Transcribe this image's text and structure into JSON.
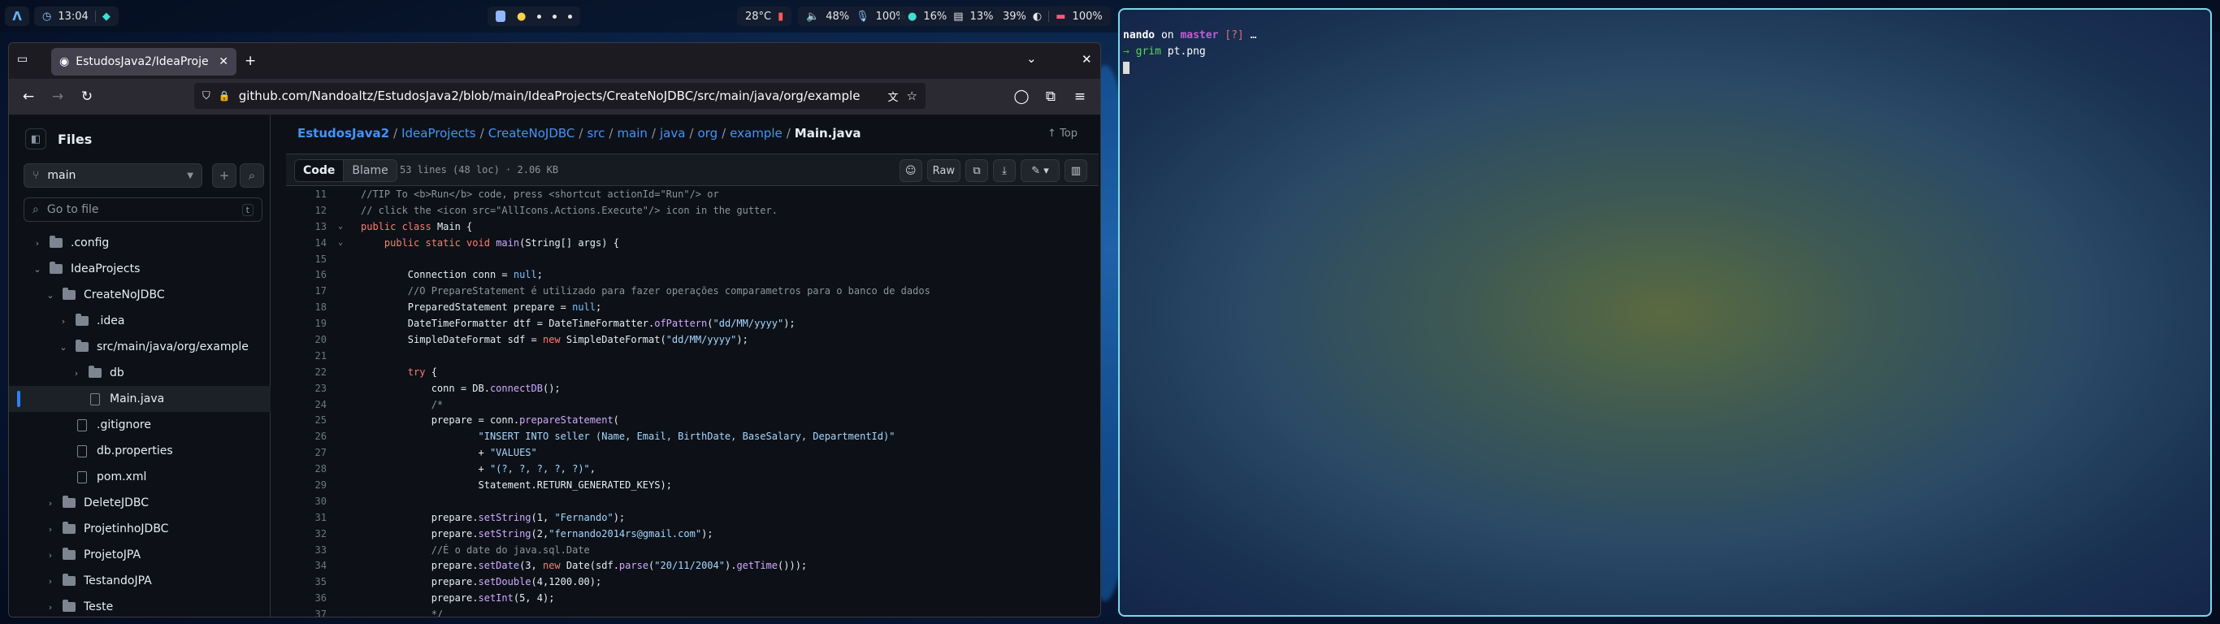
{
  "topbar": {
    "launcher_icon": "arch-logo-icon",
    "time": "13:04",
    "workspaces": [
      "1",
      "2",
      "3",
      "4",
      "5"
    ],
    "temperature": "28°C",
    "volume": "48%",
    "mic": "100%",
    "cpu": "16%",
    "memory": "13%",
    "brightness": "39%",
    "battery": "100%"
  },
  "browser": {
    "tab_title": "EstudosJava2/IdeaProje",
    "url": "github.com/Nandoaltz/EstudosJava2/blob/main/IdeaProjects/CreateNoJDBC/src/main/java/org/example"
  },
  "sidebar": {
    "title": "Files",
    "branch": "main",
    "goto_placeholder": "Go to file",
    "goto_shortcut": "t",
    "tree": [
      {
        "label": ".config",
        "type": "folder",
        "depth": 0,
        "state": "collapsed"
      },
      {
        "label": "IdeaProjects",
        "type": "folder",
        "depth": 0,
        "state": "expanded"
      },
      {
        "label": "CreateNoJDBC",
        "type": "folder",
        "depth": 1,
        "state": "expanded"
      },
      {
        "label": ".idea",
        "type": "folder",
        "depth": 2,
        "state": "collapsed"
      },
      {
        "label": "src/main/java/org/example",
        "type": "folder",
        "depth": 2,
        "state": "expanded"
      },
      {
        "label": "db",
        "type": "folder",
        "depth": 3,
        "state": "collapsed"
      },
      {
        "label": "Main.java",
        "type": "file",
        "depth": 3,
        "state": "active"
      },
      {
        "label": ".gitignore",
        "type": "file",
        "depth": 2,
        "state": ""
      },
      {
        "label": "db.properties",
        "type": "file",
        "depth": 2,
        "state": ""
      },
      {
        "label": "pom.xml",
        "type": "file",
        "depth": 2,
        "state": ""
      },
      {
        "label": "DeleteJDBC",
        "type": "folder",
        "depth": 1,
        "state": "collapsed"
      },
      {
        "label": "ProjetinhoJDBC",
        "type": "folder",
        "depth": 1,
        "state": "collapsed"
      },
      {
        "label": "ProjetoJPA",
        "type": "folder",
        "depth": 1,
        "state": "collapsed"
      },
      {
        "label": "TestandoJPA",
        "type": "folder",
        "depth": 1,
        "state": "collapsed"
      },
      {
        "label": "Teste",
        "type": "folder",
        "depth": 1,
        "state": "collapsed"
      }
    ]
  },
  "breadcrumb": {
    "repo": "EstudosJava2",
    "parts": [
      "IdeaProjects",
      "CreateNoJDBC",
      "src",
      "main",
      "java",
      "org",
      "example"
    ],
    "current": "Main.java",
    "top_link": "Top"
  },
  "codebar": {
    "code_label": "Code",
    "blame_label": "Blame",
    "meta": "53 lines (48 loc) · 2.06 KB",
    "raw_label": "Raw"
  },
  "code_lines": [
    {
      "n": "11",
      "fold": "",
      "html": "<span class=\"c\">//TIP To &lt;b&gt;Run&lt;/b&gt; code, press &lt;shortcut actionId=\"Run\"/&gt; or</span>"
    },
    {
      "n": "12",
      "fold": "",
      "html": "<span class=\"c\">// click the &lt;icon src=\"AllIcons.Actions.Execute\"/&gt; icon in the gutter.</span>"
    },
    {
      "n": "13",
      "fold": "v",
      "html": "<span class=\"k\">public class</span> <span class=\"t\">Main {</span>"
    },
    {
      "n": "14",
      "fold": "v",
      "html": "    <span class=\"k\">public static void</span> <span class=\"f\">main</span><span class=\"t\">(String[] args) {</span>"
    },
    {
      "n": "15",
      "fold": "",
      "html": ""
    },
    {
      "n": "16",
      "fold": "",
      "html": "        <span class=\"t\">Connection conn = </span><span class=\"n\">null</span><span class=\"t\">;</span>"
    },
    {
      "n": "17",
      "fold": "",
      "html": "        <span class=\"c\">//O PrepareStatement é utilizado para fazer operações comparametros para o banco de dados</span>"
    },
    {
      "n": "18",
      "fold": "",
      "html": "        <span class=\"t\">PreparedStatement prepare = </span><span class=\"n\">null</span><span class=\"t\">;</span>"
    },
    {
      "n": "19",
      "fold": "",
      "html": "        <span class=\"t\">DateTimeFormatter dtf = DateTimeFormatter.</span><span class=\"f\">ofPattern</span><span class=\"t\">(</span><span class=\"s\">\"dd/MM/yyyy\"</span><span class=\"t\">);</span>"
    },
    {
      "n": "20",
      "fold": "",
      "html": "        <span class=\"t\">SimpleDateFormat sdf = </span><span class=\"k\">new</span><span class=\"t\"> SimpleDateFormat(</span><span class=\"s\">\"dd/MM/yyyy\"</span><span class=\"t\">);</span>"
    },
    {
      "n": "21",
      "fold": "",
      "html": ""
    },
    {
      "n": "22",
      "fold": "",
      "html": "        <span class=\"k\">try</span><span class=\"t\"> {</span>"
    },
    {
      "n": "23",
      "fold": "",
      "html": "            <span class=\"t\">conn = DB.</span><span class=\"f\">connectDB</span><span class=\"t\">();</span>"
    },
    {
      "n": "24",
      "fold": "",
      "html": "            <span class=\"c\">/*</span>"
    },
    {
      "n": "25",
      "fold": "",
      "html": "            <span class=\"t\">prepare = conn.</span><span class=\"f\">prepareStatement</span><span class=\"t\">(</span>"
    },
    {
      "n": "26",
      "fold": "",
      "html": "                    <span class=\"s\">\"INSERT INTO seller (Name, Email, BirthDate, BaseSalary, DepartmentId)\"</span>"
    },
    {
      "n": "27",
      "fold": "",
      "html": "                    <span class=\"t\">+ </span><span class=\"s\">\"VALUES\"</span>"
    },
    {
      "n": "28",
      "fold": "",
      "html": "                    <span class=\"t\">+ </span><span class=\"s\">\"(?, ?, ?, ?, ?)\"</span><span class=\"t\">,</span>"
    },
    {
      "n": "29",
      "fold": "",
      "html": "                    <span class=\"t\">Statement.RETURN_GENERATED_KEYS);</span>"
    },
    {
      "n": "30",
      "fold": "",
      "html": ""
    },
    {
      "n": "31",
      "fold": "",
      "html": "            <span class=\"t\">prepare.</span><span class=\"f\">setString</span><span class=\"t\">(1, </span><span class=\"s\">\"Fernando\"</span><span class=\"t\">);</span>"
    },
    {
      "n": "32",
      "fold": "",
      "html": "            <span class=\"t\">prepare.</span><span class=\"f\">setString</span><span class=\"t\">(2,</span><span class=\"s\">\"fernando2014rs@gmail.com\"</span><span class=\"t\">);</span>"
    },
    {
      "n": "33",
      "fold": "",
      "html": "            <span class=\"c\">//É o date do java.sql.Date</span>"
    },
    {
      "n": "34",
      "fold": "",
      "html": "            <span class=\"t\">prepare.</span><span class=\"f\">setDate</span><span class=\"t\">(3, </span><span class=\"k\">new</span><span class=\"t\"> Date(sdf.</span><span class=\"f\">parse</span><span class=\"t\">(</span><span class=\"s\">\"20/11/2004\"</span><span class=\"t\">).</span><span class=\"f\">getTime</span><span class=\"t\">()));</span>"
    },
    {
      "n": "35",
      "fold": "",
      "html": "            <span class=\"t\">prepare.</span><span class=\"f\">setDouble</span><span class=\"t\">(4,1200.00);</span>"
    },
    {
      "n": "36",
      "fold": "",
      "html": "            <span class=\"t\">prepare.</span><span class=\"f\">setInt</span><span class=\"t\">(5, 4);</span>"
    },
    {
      "n": "37",
      "fold": "",
      "html": "            <span class=\"c\">*/</span>"
    }
  ],
  "terminal": {
    "user": "nando",
    "on": "on",
    "branch_icon": "",
    "branch": "master",
    "status": "[?]",
    "ellipsis": "…",
    "prompt_arrow": "→",
    "command": "grim",
    "arg": "pt.png"
  },
  "colors": {
    "accent": "#4493f8",
    "terminal_border": "#7fd6e8",
    "branch": "#c65bd6"
  }
}
